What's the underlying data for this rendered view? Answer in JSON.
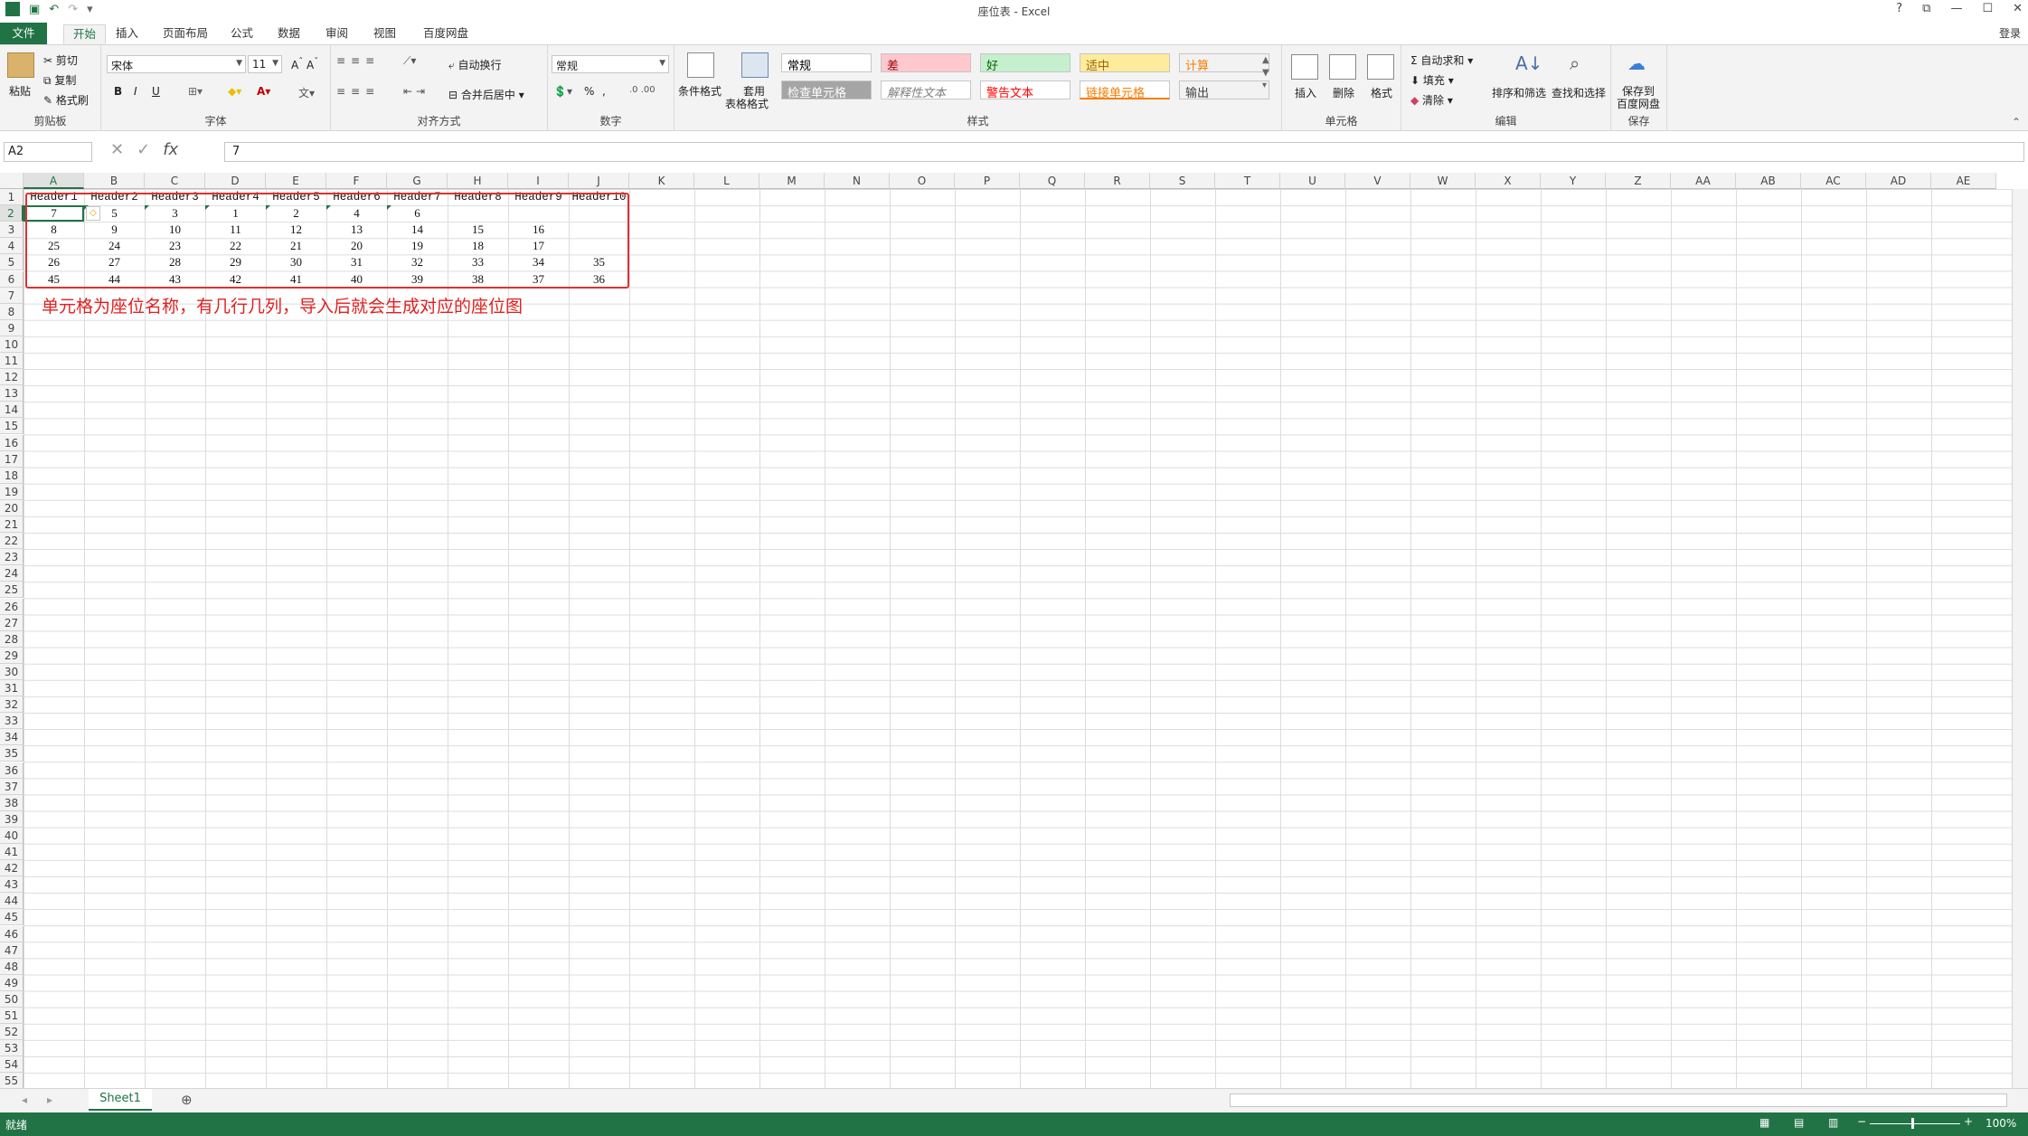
{
  "window": {
    "title": "座位表 - Excel",
    "login": "登录",
    "help": "?",
    "restore": "⧉",
    "minimize": "—",
    "maximize": "☐",
    "close": "✕"
  },
  "tabs": [
    "文件",
    "开始",
    "插入",
    "页面布局",
    "公式",
    "数据",
    "审阅",
    "视图",
    "百度网盘"
  ],
  "ribbon": {
    "clipboard": {
      "label": "剪贴板",
      "paste": "粘贴",
      "cut": "剪切",
      "copy": "复制",
      "format_painter": "格式刷"
    },
    "font": {
      "label": "字体",
      "name": "宋体",
      "size": "11",
      "bold": "B",
      "italic": "I",
      "underline": "U"
    },
    "alignment": {
      "label": "对齐方式",
      "wrap": "自动换行",
      "merge": "合并后居中"
    },
    "number": {
      "label": "数字",
      "format": "常规",
      "percent": "%",
      "comma": ","
    },
    "styles": {
      "label": "样式",
      "conditional": "条件格式",
      "table1": "套用",
      "table2": "表格格式",
      "items": [
        {
          "text": "常规",
          "bg": "#ffffff",
          "color": "#000000"
        },
        {
          "text": "差",
          "bg": "#ffc7ce",
          "color": "#9c0006"
        },
        {
          "text": "好",
          "bg": "#c6efce",
          "color": "#006100"
        },
        {
          "text": "适中",
          "bg": "#ffeb9c",
          "color": "#9c6500"
        },
        {
          "text": "计算",
          "bg": "#f2f2f2",
          "color": "#fa7d00"
        },
        {
          "text": "检查单元格",
          "bg": "#a5a5a5",
          "color": "#ffffff"
        },
        {
          "text": "解释性文本",
          "bg": "#ffffff",
          "color": "#7f7f7f"
        },
        {
          "text": "警告文本",
          "bg": "#ffffff",
          "color": "#ff0000"
        },
        {
          "text": "链接单元格",
          "bg": "#ffffff",
          "color": "#fa7d00"
        },
        {
          "text": "输出",
          "bg": "#f2f2f2",
          "color": "#3f3f3f"
        }
      ]
    },
    "cells": {
      "label": "单元格",
      "insert": "插入",
      "delete": "删除",
      "format": "格式"
    },
    "editing": {
      "label": "编辑",
      "autosum": "自动求和",
      "fill": "填充",
      "clear": "清除",
      "sort": "排序和筛选",
      "find": "查找和选择"
    },
    "save": {
      "label": "保存",
      "btn1": "保存到",
      "btn2": "百度网盘"
    }
  },
  "formula": {
    "namebox": "A2",
    "fx": "fx",
    "value": "7"
  },
  "columns": [
    "A",
    "B",
    "C",
    "D",
    "E",
    "F",
    "G",
    "H",
    "I",
    "J",
    "K",
    "L",
    "M",
    "N",
    "O",
    "P",
    "Q",
    "R",
    "S",
    "T",
    "U",
    "V",
    "W",
    "X",
    "Y",
    "Z",
    "AA",
    "AB",
    "AC",
    "AD",
    "AE"
  ],
  "rows": 55,
  "sheet": {
    "headers": [
      "Header1",
      "Header2",
      "Header3",
      "Header4",
      "Header5",
      "Header6",
      "Header7",
      "Header8",
      "Header9",
      "Header10"
    ],
    "data": [
      [
        "7",
        "5",
        "3",
        "1",
        "2",
        "4",
        "6",
        "",
        "",
        ""
      ],
      [
        "8",
        "9",
        "10",
        "11",
        "12",
        "13",
        "14",
        "15",
        "16",
        ""
      ],
      [
        "25",
        "24",
        "23",
        "22",
        "21",
        "20",
        "19",
        "18",
        "17",
        ""
      ],
      [
        "26",
        "27",
        "28",
        "29",
        "30",
        "31",
        "32",
        "33",
        "34",
        "35"
      ],
      [
        "45",
        "44",
        "43",
        "42",
        "41",
        "40",
        "39",
        "38",
        "37",
        "36"
      ]
    ],
    "annotation": "单元格为座位名称，有几行几列，导入后就会生成对应的座位图"
  },
  "sheet_tab": "Sheet1",
  "status": {
    "ready": "就绪",
    "zoom": "100%"
  },
  "colors": {
    "accent": "#217346",
    "annotation": "#e02020"
  }
}
